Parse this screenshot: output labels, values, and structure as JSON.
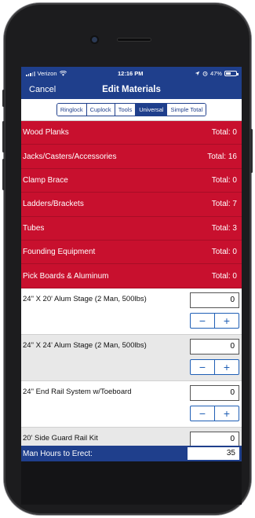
{
  "status_bar": {
    "carrier": "Verizon",
    "time": "12:16 PM",
    "battery": "47%",
    "battery_level": 0.47
  },
  "nav": {
    "cancel_label": "Cancel",
    "title": "Edit Materials"
  },
  "segments": [
    {
      "label": "Ringlock",
      "active": false
    },
    {
      "label": "Cuplock",
      "active": false
    },
    {
      "label": "Tools",
      "active": false
    },
    {
      "label": "Universal",
      "active": true
    },
    {
      "label": "Simple Total",
      "active": false
    }
  ],
  "categories": [
    {
      "name": "Wood Planks",
      "total": "Total: 0"
    },
    {
      "name": "Jacks/Casters/Accessories",
      "total": "Total: 16"
    },
    {
      "name": "Clamp Brace",
      "total": "Total: 0"
    },
    {
      "name": "Ladders/Brackets",
      "total": "Total: 7"
    },
    {
      "name": "Tubes",
      "total": "Total: 3"
    },
    {
      "name": "Founding Equipment",
      "total": "Total: 0"
    },
    {
      "name": "Pick Boards & Aluminum",
      "total": "Total: 0"
    }
  ],
  "items": [
    {
      "name": "24\" X 20' Alum Stage (2 Man, 500lbs)",
      "qty": "0"
    },
    {
      "name": "24\" X 24' Alum Stage (2 Man, 500lbs)",
      "qty": "0"
    },
    {
      "name": "24\" End Rail System w/Toeboard",
      "qty": "0"
    },
    {
      "name": "20' Side Guard Rail Kit",
      "qty": "0"
    }
  ],
  "stepper": {
    "minus": "−",
    "plus": "+"
  },
  "footer": {
    "label": "Man Hours to Erect:",
    "value": "35"
  },
  "colors": {
    "nav_blue": "#1f3f8c",
    "category_red": "#c8102e",
    "stepper_blue": "#1f5fb5",
    "alt_row_gray": "#e8e8e8"
  }
}
